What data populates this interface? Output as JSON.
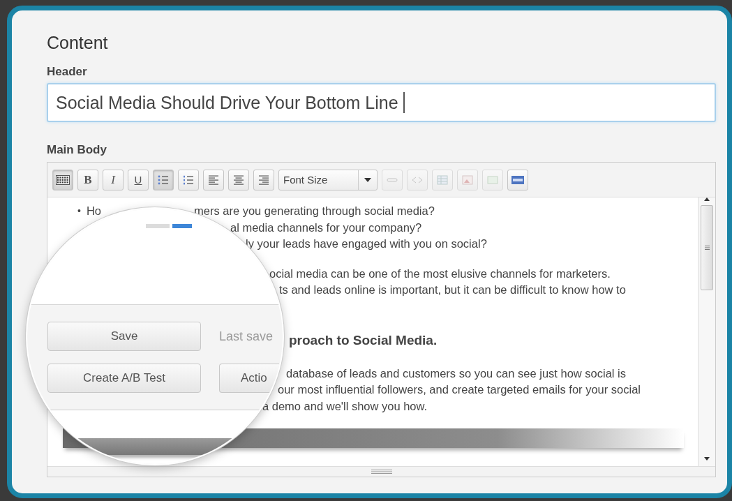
{
  "panel": {
    "title": "Content"
  },
  "header_field": {
    "label": "Header",
    "value": "Social Media Should Drive Your Bottom Line"
  },
  "main_body": {
    "label": "Main Body",
    "toolbar": [
      {
        "kind": "keyboard",
        "selected": true,
        "disabled": false
      },
      {
        "kind": "bold",
        "label": "B",
        "selected": false,
        "disabled": false
      },
      {
        "kind": "italic",
        "label": "I",
        "selected": false,
        "disabled": false
      },
      {
        "kind": "underline",
        "label": "U",
        "selected": false,
        "disabled": false
      },
      {
        "kind": "bullets",
        "selected": true,
        "disabled": false
      },
      {
        "kind": "numbers",
        "selected": false,
        "disabled": false
      },
      {
        "kind": "alignleft",
        "selected": false,
        "disabled": false
      },
      {
        "kind": "aligncenter",
        "selected": false,
        "disabled": false
      },
      {
        "kind": "alignright",
        "selected": false,
        "disabled": false
      },
      {
        "kind": "select",
        "label": "Font Size",
        "disabled": false
      },
      {
        "kind": "link",
        "selected": false,
        "disabled": true
      },
      {
        "kind": "unlink",
        "selected": false,
        "disabled": true
      },
      {
        "kind": "table",
        "selected": false,
        "disabled": true
      },
      {
        "kind": "image",
        "selected": false,
        "disabled": true
      },
      {
        "kind": "media",
        "selected": false,
        "disabled": true
      },
      {
        "kind": "html",
        "selected": false,
        "disabled": false
      }
    ],
    "lines": [
      {
        "kind": "bullet",
        "bullet": "•",
        "lead": "Ho",
        "text": "mers are you generating through social media?"
      },
      {
        "kind": "line",
        "text": "al media channels for your company?"
      },
      {
        "kind": "line",
        "text": "ly your leads have engaged with you on social?"
      },
      {
        "kind": "line",
        "text": "ocial media can be one of the most elusive channels for marketers."
      },
      {
        "kind": "line",
        "text": "ts and leads online is important, but it can be difficult to know how to"
      },
      {
        "kind": "heading",
        "text": "proach to Social Media."
      },
      {
        "kind": "line",
        "text": "database of leads and customers so you can see just how social is"
      },
      {
        "kind": "line",
        "text": "our most influential followers, and create targeted emails for your social"
      },
      {
        "kind": "line",
        "text": "a demo and we'll show you how."
      }
    ]
  },
  "magnifier": {
    "save_button": "Save",
    "status": "Last save",
    "ab_button": "Create A/B Test",
    "actions_button": "Actio"
  }
}
